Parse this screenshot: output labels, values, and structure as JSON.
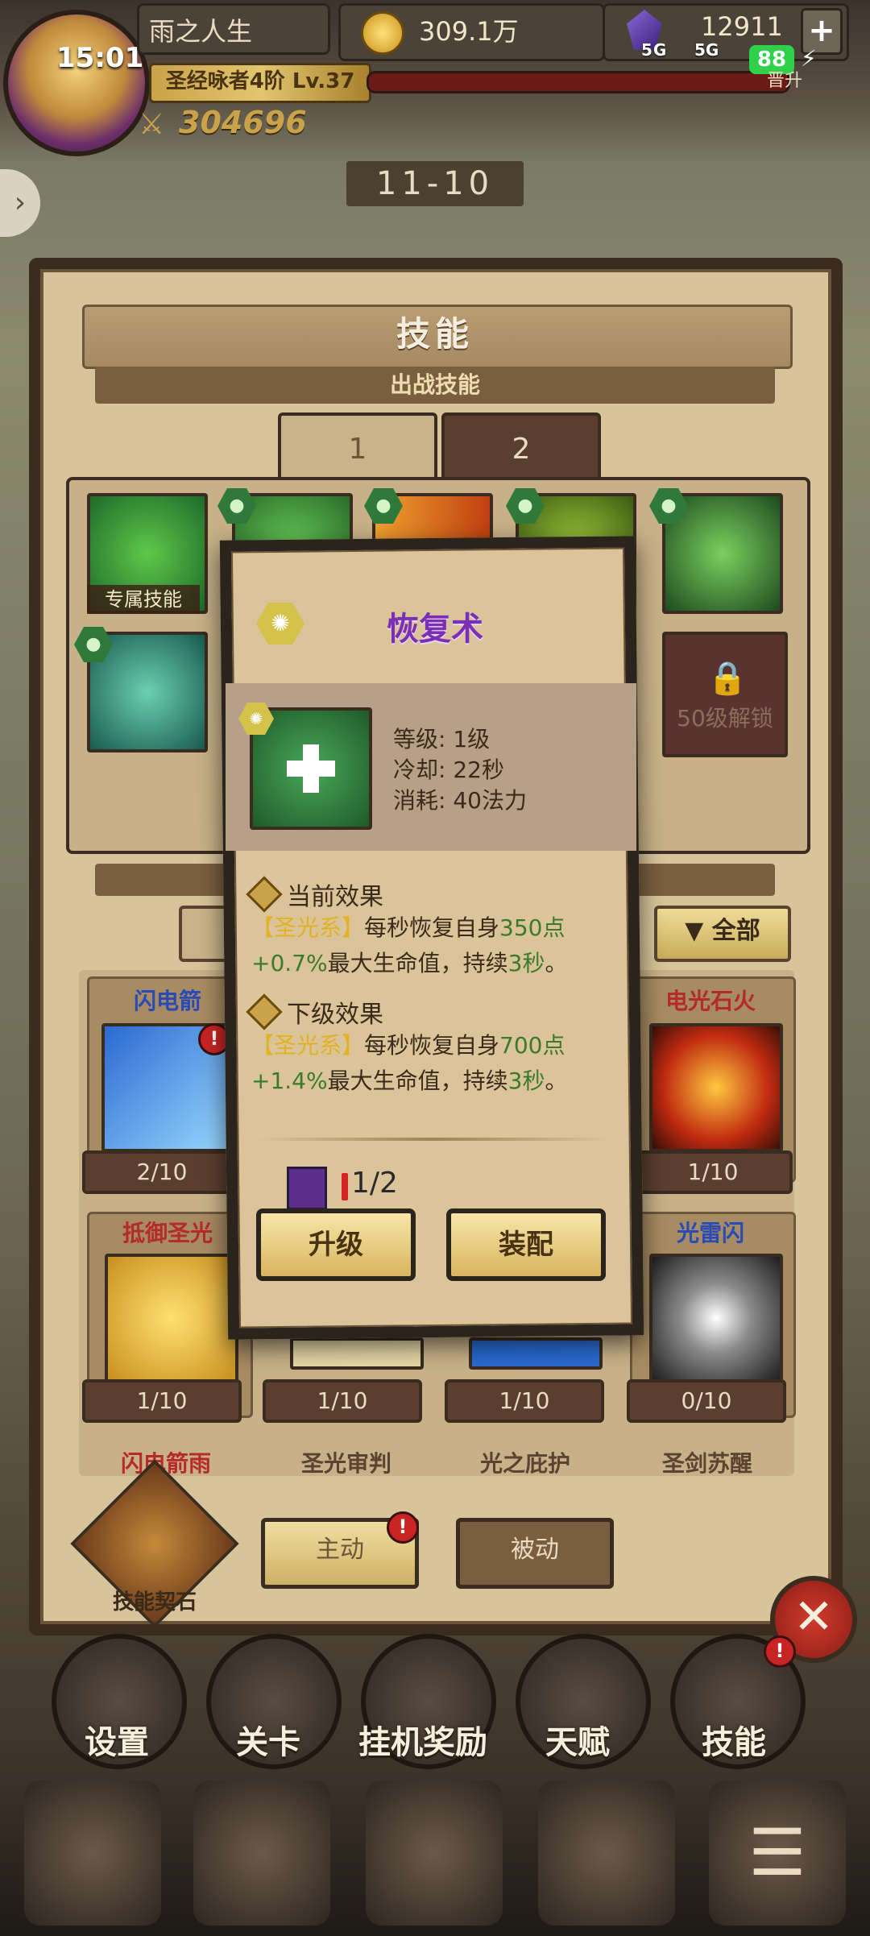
{
  "status": {
    "time": "15:01",
    "network1": "5G",
    "network2": "5G",
    "battery": "88"
  },
  "player": {
    "name": "雨之人生",
    "rank": "圣经咏者4阶 Lv.37",
    "power": "304696"
  },
  "currency": {
    "gold": "309.1万",
    "gems": "12911"
  },
  "top_right_label": "晋升",
  "stage": "11-10",
  "panel": {
    "title": "技能",
    "section": "出战技能",
    "tabs": [
      "1",
      "2"
    ],
    "exclusive_tag": "专属技能",
    "lock_text": "50级解锁",
    "filter": "全部",
    "cards_row1": [
      {
        "title": "闪电箭",
        "count": "2/10"
      },
      {
        "title": "电光石火",
        "count": "1/10"
      }
    ],
    "cards_row2": [
      {
        "title": "抵御圣光",
        "count": "1/10"
      },
      {
        "title": "",
        "count": "1/10"
      },
      {
        "title": "",
        "count": "1/10"
      },
      {
        "title": "光雷闪",
        "count": "0/10"
      }
    ],
    "cards_row3": [
      "闪电箭雨",
      "圣光审判",
      "光之庇护",
      "圣剑苏醒"
    ],
    "stone_label": "技能契石",
    "btn_active": "主动",
    "btn_passive": "被动",
    "close": "✕"
  },
  "menu": [
    "设置",
    "关卡",
    "挂机奖励",
    "天赋",
    "技能"
  ],
  "modal": {
    "title": "恢复术",
    "level": "等级: 1级",
    "cooldown": "冷却: 22秒",
    "cost": "消耗: 40法力",
    "current_head": "当前效果",
    "current": {
      "tag": "【圣光系】",
      "pre": "每秒恢复自身",
      "num": "350点+0.7%",
      "post": "最大生命值，持续",
      "dur": "3秒",
      "end": "。"
    },
    "next_head": "下级效果",
    "next": {
      "tag": "【圣光系】",
      "pre": "每秒恢复自身",
      "num": "700点+1.4%",
      "post": "最大生命值，持续",
      "dur": "3秒",
      "end": "。"
    },
    "fragments": "1/2",
    "upgrade": "升级",
    "equip": "装配"
  }
}
